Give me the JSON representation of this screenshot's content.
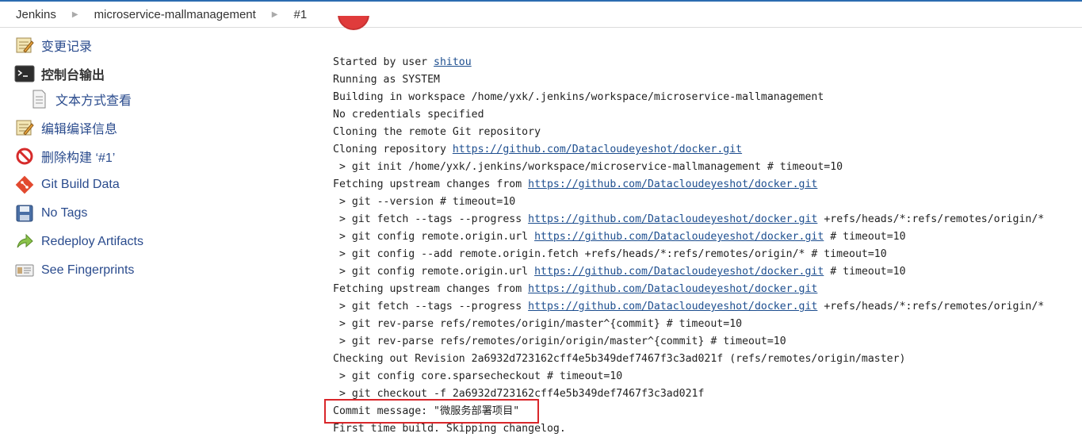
{
  "breadcrumb": [
    "Jenkins",
    "microservice-mallmanagement",
    "#1"
  ],
  "sidebar": {
    "items": [
      {
        "label": "变更记录",
        "icon": "notepad-icon"
      },
      {
        "label": "控制台输出",
        "icon": "terminal-icon"
      },
      {
        "label": "文本方式查看",
        "icon": "document-icon"
      },
      {
        "label": "编辑编译信息",
        "icon": "notepad-icon"
      },
      {
        "label": "删除构建 ‘#1’",
        "icon": "no-entry-icon"
      },
      {
        "label": "Git Build Data",
        "icon": "git-icon"
      },
      {
        "label": "No Tags",
        "icon": "floppy-disk-icon"
      },
      {
        "label": "Redeploy Artifacts",
        "icon": "redeploy-arrow-icon"
      },
      {
        "label": "See Fingerprints",
        "icon": "fingerprint-card-icon"
      }
    ]
  },
  "console": {
    "lines": [
      [
        {
          "t": "Started by user "
        },
        {
          "t": "shitou",
          "link": true
        }
      ],
      [
        {
          "t": "Running as SYSTEM"
        }
      ],
      [
        {
          "t": "Building in workspace /home/yxk/.jenkins/workspace/microservice-mallmanagement"
        }
      ],
      [
        {
          "t": "No credentials specified"
        }
      ],
      [
        {
          "t": "Cloning the remote Git repository"
        }
      ],
      [
        {
          "t": "Cloning repository "
        },
        {
          "t": "https://github.com/Datacloudeyeshot/docker.git",
          "link": true
        }
      ],
      [
        {
          "t": " > git init /home/yxk/.jenkins/workspace/microservice-mallmanagement # timeout=10"
        }
      ],
      [
        {
          "t": "Fetching upstream changes from "
        },
        {
          "t": "https://github.com/Datacloudeyeshot/docker.git",
          "link": true
        }
      ],
      [
        {
          "t": " > git --version # timeout=10"
        }
      ],
      [
        {
          "t": " > git fetch --tags --progress "
        },
        {
          "t": "https://github.com/Datacloudeyeshot/docker.git",
          "link": true
        },
        {
          "t": " +refs/heads/*:refs/remotes/origin/*"
        }
      ],
      [
        {
          "t": " > git config remote.origin.url "
        },
        {
          "t": "https://github.com/Datacloudeyeshot/docker.git",
          "link": true
        },
        {
          "t": " # timeout=10"
        }
      ],
      [
        {
          "t": " > git config --add remote.origin.fetch +refs/heads/*:refs/remotes/origin/* # timeout=10"
        }
      ],
      [
        {
          "t": " > git config remote.origin.url "
        },
        {
          "t": "https://github.com/Datacloudeyeshot/docker.git",
          "link": true
        },
        {
          "t": " # timeout=10"
        }
      ],
      [
        {
          "t": "Fetching upstream changes from "
        },
        {
          "t": "https://github.com/Datacloudeyeshot/docker.git",
          "link": true
        }
      ],
      [
        {
          "t": " > git fetch --tags --progress "
        },
        {
          "t": "https://github.com/Datacloudeyeshot/docker.git",
          "link": true
        },
        {
          "t": " +refs/heads/*:refs/remotes/origin/*"
        }
      ],
      [
        {
          "t": " > git rev-parse refs/remotes/origin/master^{commit} # timeout=10"
        }
      ],
      [
        {
          "t": " > git rev-parse refs/remotes/origin/origin/master^{commit} # timeout=10"
        }
      ],
      [
        {
          "t": "Checking out Revision 2a6932d723162cff4e5b349def7467f3c3ad021f (refs/remotes/origin/master)"
        }
      ],
      [
        {
          "t": " > git config core.sparsecheckout # timeout=10"
        }
      ],
      [
        {
          "t": " > git checkout -f 2a6932d723162cff4e5b349def7467f3c3ad021f"
        }
      ],
      [
        {
          "t": "Commit message: \"微服务部署项目\""
        }
      ],
      [
        {
          "t": "First time build. Skipping changelog."
        }
      ]
    ]
  },
  "colors": {
    "link": "#1d4e8f",
    "highlight_border": "#d9262a",
    "accent": "#2b6cb0"
  }
}
